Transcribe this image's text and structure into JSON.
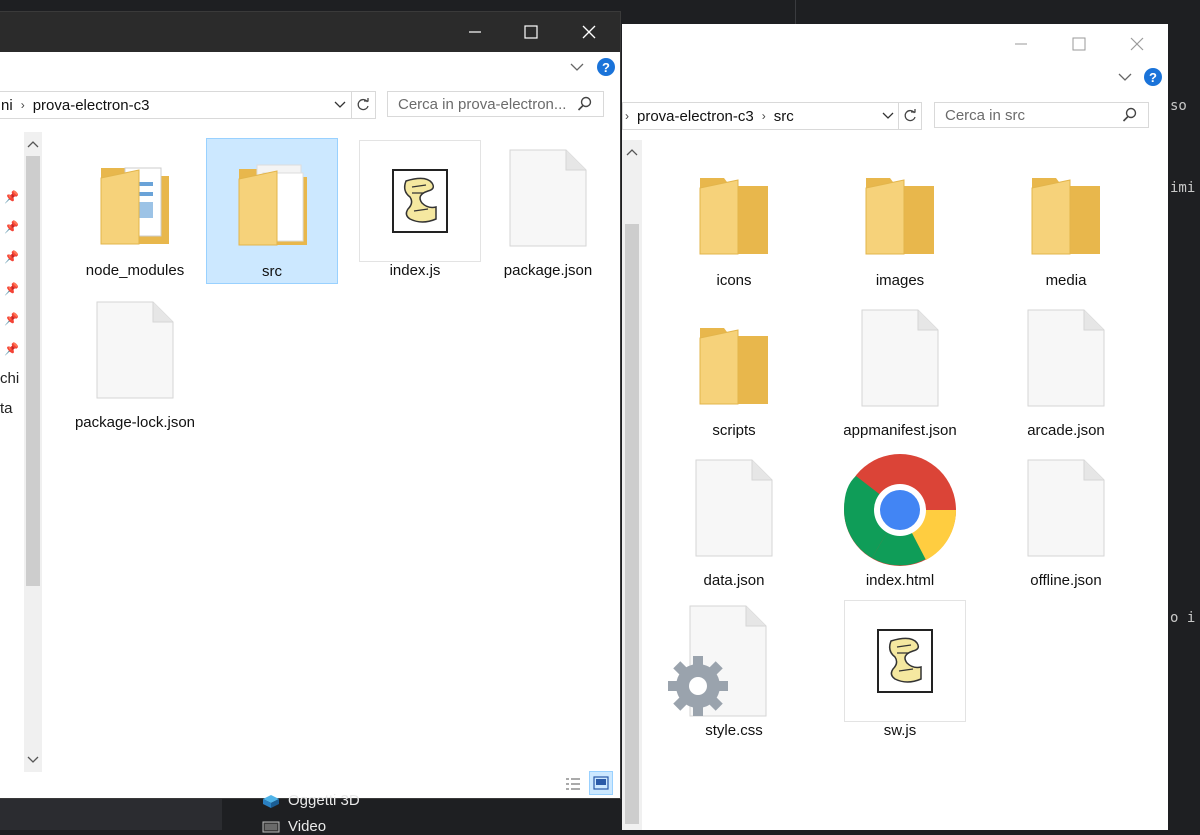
{
  "background": {
    "code_fragments": [
      "so",
      "imi",
      "o i",
      "Oggetti 3D",
      "Video"
    ]
  },
  "left_window": {
    "breadcrumb": [
      "ni",
      "prova-electron-c3"
    ],
    "search_placeholder": "Cerca in prova-electron...",
    "help_label": "?",
    "sidebar_fragments": [
      "chi",
      "ta"
    ],
    "items": [
      {
        "label": "node_modules",
        "type": "folder-docs"
      },
      {
        "label": "src",
        "type": "folder-selected"
      },
      {
        "label": "index.js",
        "type": "script-thumb"
      },
      {
        "label": "package.json",
        "type": "file"
      },
      {
        "label": "package-lock.json",
        "type": "file"
      }
    ]
  },
  "right_window": {
    "breadcrumb": [
      "prova-electron-c3",
      "src"
    ],
    "search_placeholder": "Cerca in src",
    "help_label": "?",
    "items": [
      {
        "label": "icons",
        "type": "folder"
      },
      {
        "label": "images",
        "type": "folder"
      },
      {
        "label": "media",
        "type": "folder"
      },
      {
        "label": "scripts",
        "type": "folder"
      },
      {
        "label": "appmanifest.json",
        "type": "file"
      },
      {
        "label": "arcade.json",
        "type": "file"
      },
      {
        "label": "data.json",
        "type": "file"
      },
      {
        "label": "index.html",
        "type": "chrome"
      },
      {
        "label": "offline.json",
        "type": "file"
      },
      {
        "label": "style.css",
        "type": "css"
      },
      {
        "label": "sw.js",
        "type": "script-thumb"
      }
    ]
  }
}
